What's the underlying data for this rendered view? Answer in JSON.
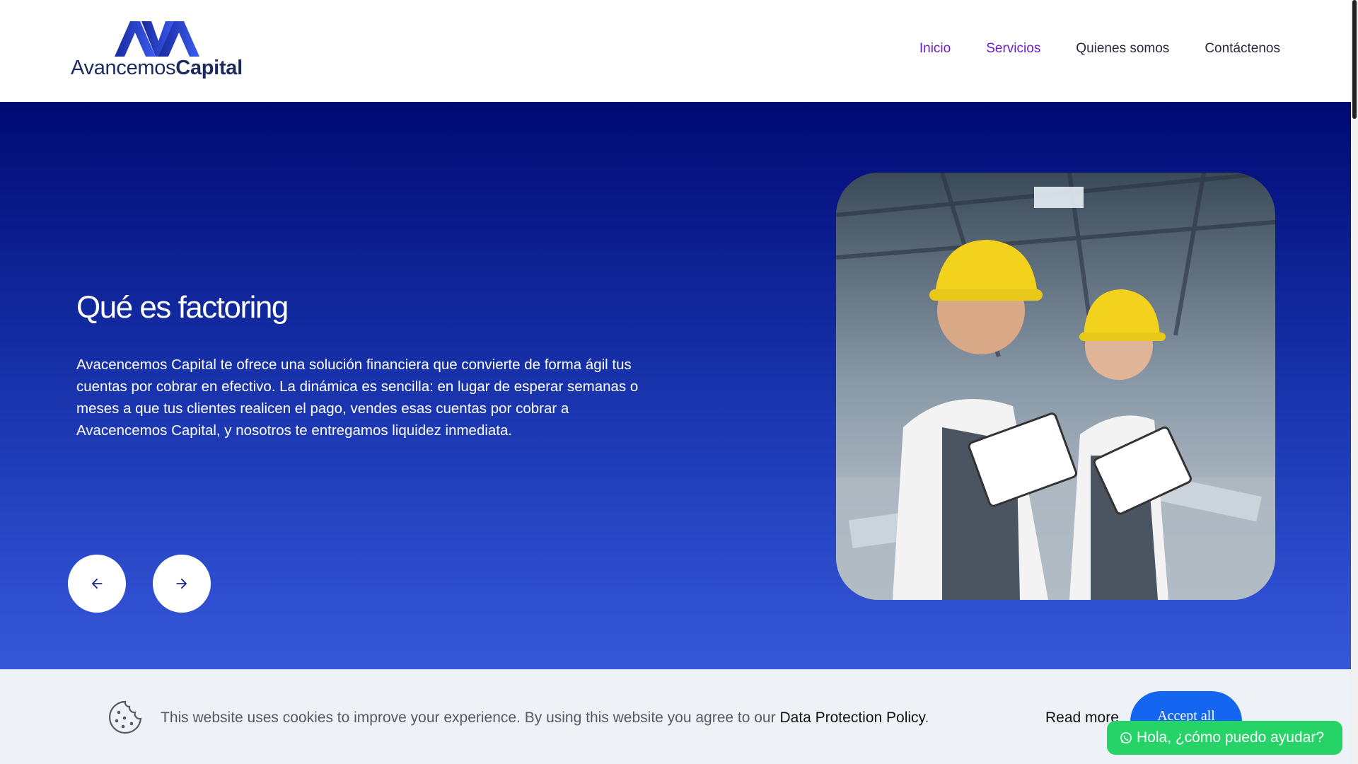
{
  "header": {
    "logo": {
      "mark": "AVA",
      "text_light": "Avancemos",
      "text_bold": "Capital"
    },
    "nav": [
      {
        "label": "Inicio",
        "active": true
      },
      {
        "label": "Servicios",
        "active": true
      },
      {
        "label": "Quienes somos",
        "active": false
      },
      {
        "label": "Contáctenos",
        "active": false
      }
    ]
  },
  "hero": {
    "title": "Qué es factoring",
    "text": "Avacencemos Capital te ofrece una solución financiera que convierte de forma ágil tus cuentas por cobrar en efectivo. La dinámica es sencilla: en lugar de esperar semanas o meses a que tus clientes realicen el pago, vendes esas cuentas por cobrar a Avacencemos Capital, y nosotros te entregamos liquidez inmediata.",
    "prev_icon": "arrow-left-icon",
    "next_icon": "arrow-right-icon"
  },
  "cookie": {
    "text": "This website uses cookies to improve your experience. By using this website you agree to our ",
    "policy_link": "Data Protection Policy",
    "period": ".",
    "read_more": "Read more",
    "accept": "Accept all"
  },
  "whatsapp": {
    "label": "Hola, ¿cómo puedo ayudar?"
  },
  "colors": {
    "nav_active": "#6a1bd6",
    "hero_top": "#000a73",
    "hero_bottom": "#3c63dc",
    "accept": "#1466f0",
    "whatsapp": "#25d366"
  }
}
